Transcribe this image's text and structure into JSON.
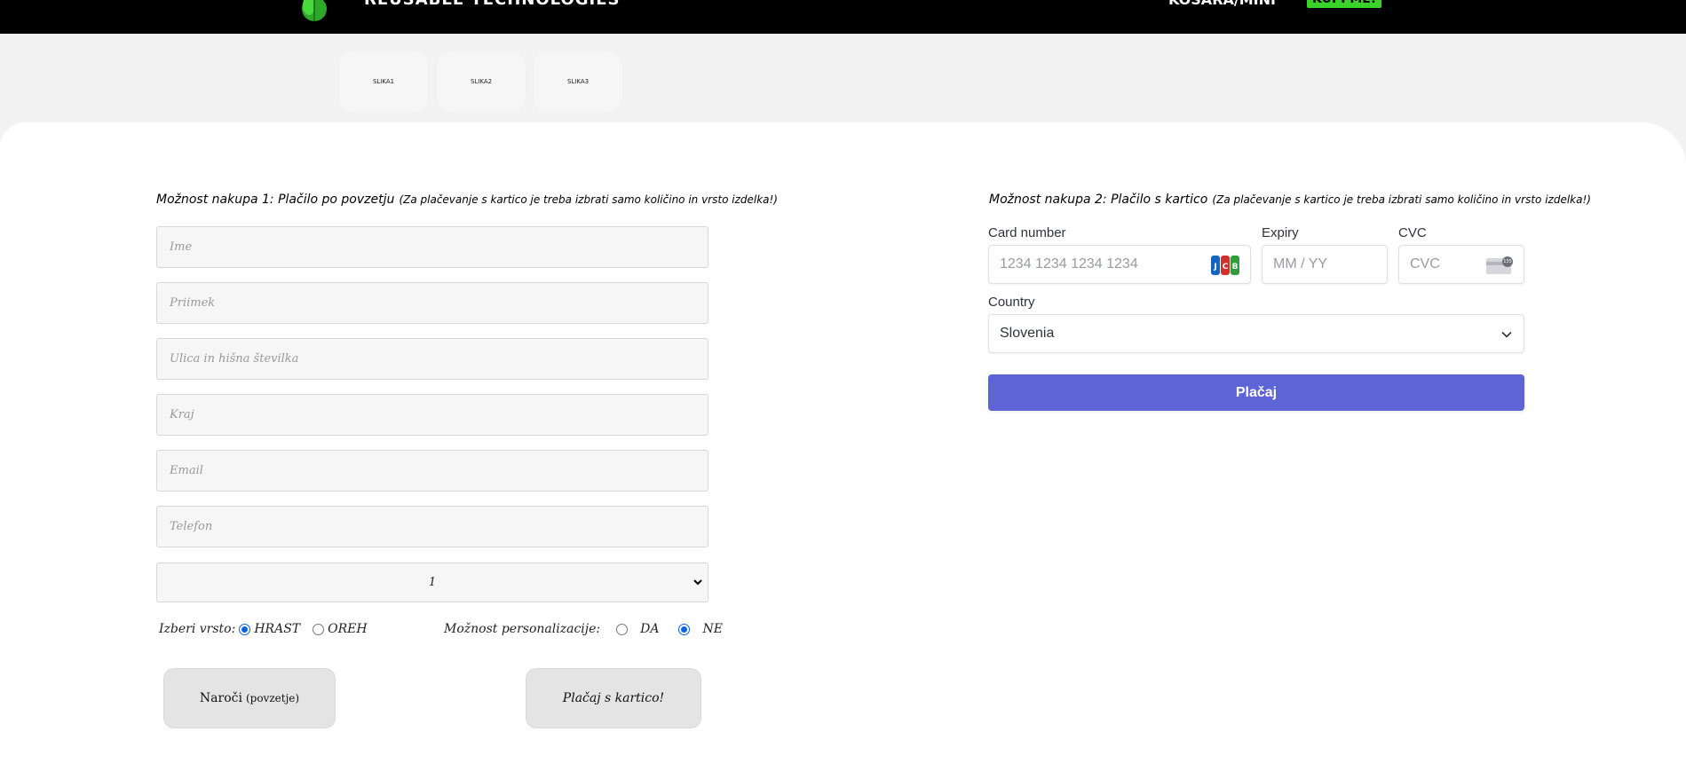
{
  "header": {
    "brand": "REUSABLE TECHNOLOGIES",
    "nav_link": "KOŠARA/MINI",
    "buy_button": "KUPI ME!"
  },
  "thumbnails": [
    "SLIKA1",
    "SLIKA2",
    "SLIKA3"
  ],
  "option1": {
    "heading_main": "Možnost nakupa 1: Plačilo po povzetju",
    "heading_sub": "(Za plačevanje s kartico je treba izbrati samo količino in vrsto izdelka!)",
    "fields": {
      "first_name": "Ime",
      "last_name": "Priimek",
      "street": "Ulica in hišna številka",
      "city": "Kraj",
      "email": "Email",
      "phone": "Telefon"
    },
    "quantity_value": "1",
    "type_label": "Izberi vrsto:",
    "type_options": [
      "HRAST",
      "OREH"
    ],
    "type_selected": "HRAST",
    "personalization_label": "Možnost personalizacije:",
    "personalization_options": [
      "DA",
      "NE"
    ],
    "personalization_selected": "NE",
    "order_button": "Naroči",
    "order_button_note": "(povzetje)",
    "card_button": "Plačaj s kartico!"
  },
  "option2": {
    "heading_main": "Možnost nakupa 2: Plačilo s kartico",
    "heading_sub": "(Za plačevanje s kartico je treba izbrati samo količino in vrsto izdelka!)",
    "card_number_label": "Card number",
    "card_number_placeholder": "1234 1234 1234 1234",
    "expiry_label": "Expiry",
    "expiry_placeholder": "MM / YY",
    "cvc_label": "CVC",
    "cvc_placeholder": "CVC",
    "cvc_icon_badge": "135",
    "country_label": "Country",
    "country_value": "Slovenia",
    "pay_button": "Plačaj"
  },
  "colors": {
    "accent_green": "#39d32a",
    "pay_button": "#5d64d5",
    "radio_selected": "#0b63e0"
  },
  "icons": [
    "leaf-logo-icon",
    "jcb-card-icon",
    "cvc-card-icon",
    "chevron-down-icon"
  ]
}
